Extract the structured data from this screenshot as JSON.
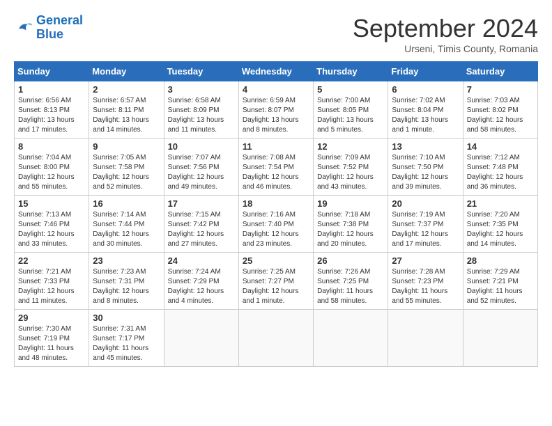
{
  "logo": {
    "line1": "General",
    "line2": "Blue"
  },
  "title": "September 2024",
  "location": "Urseni, Timis County, Romania",
  "days_of_week": [
    "Sunday",
    "Monday",
    "Tuesday",
    "Wednesday",
    "Thursday",
    "Friday",
    "Saturday"
  ],
  "weeks": [
    [
      {
        "num": "1",
        "info": "Sunrise: 6:56 AM\nSunset: 8:13 PM\nDaylight: 13 hours\nand 17 minutes."
      },
      {
        "num": "2",
        "info": "Sunrise: 6:57 AM\nSunset: 8:11 PM\nDaylight: 13 hours\nand 14 minutes."
      },
      {
        "num": "3",
        "info": "Sunrise: 6:58 AM\nSunset: 8:09 PM\nDaylight: 13 hours\nand 11 minutes."
      },
      {
        "num": "4",
        "info": "Sunrise: 6:59 AM\nSunset: 8:07 PM\nDaylight: 13 hours\nand 8 minutes."
      },
      {
        "num": "5",
        "info": "Sunrise: 7:00 AM\nSunset: 8:05 PM\nDaylight: 13 hours\nand 5 minutes."
      },
      {
        "num": "6",
        "info": "Sunrise: 7:02 AM\nSunset: 8:04 PM\nDaylight: 13 hours\nand 1 minute."
      },
      {
        "num": "7",
        "info": "Sunrise: 7:03 AM\nSunset: 8:02 PM\nDaylight: 12 hours\nand 58 minutes."
      }
    ],
    [
      {
        "num": "8",
        "info": "Sunrise: 7:04 AM\nSunset: 8:00 PM\nDaylight: 12 hours\nand 55 minutes."
      },
      {
        "num": "9",
        "info": "Sunrise: 7:05 AM\nSunset: 7:58 PM\nDaylight: 12 hours\nand 52 minutes."
      },
      {
        "num": "10",
        "info": "Sunrise: 7:07 AM\nSunset: 7:56 PM\nDaylight: 12 hours\nand 49 minutes."
      },
      {
        "num": "11",
        "info": "Sunrise: 7:08 AM\nSunset: 7:54 PM\nDaylight: 12 hours\nand 46 minutes."
      },
      {
        "num": "12",
        "info": "Sunrise: 7:09 AM\nSunset: 7:52 PM\nDaylight: 12 hours\nand 43 minutes."
      },
      {
        "num": "13",
        "info": "Sunrise: 7:10 AM\nSunset: 7:50 PM\nDaylight: 12 hours\nand 39 minutes."
      },
      {
        "num": "14",
        "info": "Sunrise: 7:12 AM\nSunset: 7:48 PM\nDaylight: 12 hours\nand 36 minutes."
      }
    ],
    [
      {
        "num": "15",
        "info": "Sunrise: 7:13 AM\nSunset: 7:46 PM\nDaylight: 12 hours\nand 33 minutes."
      },
      {
        "num": "16",
        "info": "Sunrise: 7:14 AM\nSunset: 7:44 PM\nDaylight: 12 hours\nand 30 minutes."
      },
      {
        "num": "17",
        "info": "Sunrise: 7:15 AM\nSunset: 7:42 PM\nDaylight: 12 hours\nand 27 minutes."
      },
      {
        "num": "18",
        "info": "Sunrise: 7:16 AM\nSunset: 7:40 PM\nDaylight: 12 hours\nand 23 minutes."
      },
      {
        "num": "19",
        "info": "Sunrise: 7:18 AM\nSunset: 7:38 PM\nDaylight: 12 hours\nand 20 minutes."
      },
      {
        "num": "20",
        "info": "Sunrise: 7:19 AM\nSunset: 7:37 PM\nDaylight: 12 hours\nand 17 minutes."
      },
      {
        "num": "21",
        "info": "Sunrise: 7:20 AM\nSunset: 7:35 PM\nDaylight: 12 hours\nand 14 minutes."
      }
    ],
    [
      {
        "num": "22",
        "info": "Sunrise: 7:21 AM\nSunset: 7:33 PM\nDaylight: 12 hours\nand 11 minutes."
      },
      {
        "num": "23",
        "info": "Sunrise: 7:23 AM\nSunset: 7:31 PM\nDaylight: 12 hours\nand 8 minutes."
      },
      {
        "num": "24",
        "info": "Sunrise: 7:24 AM\nSunset: 7:29 PM\nDaylight: 12 hours\nand 4 minutes."
      },
      {
        "num": "25",
        "info": "Sunrise: 7:25 AM\nSunset: 7:27 PM\nDaylight: 12 hours\nand 1 minute."
      },
      {
        "num": "26",
        "info": "Sunrise: 7:26 AM\nSunset: 7:25 PM\nDaylight: 11 hours\nand 58 minutes."
      },
      {
        "num": "27",
        "info": "Sunrise: 7:28 AM\nSunset: 7:23 PM\nDaylight: 11 hours\nand 55 minutes."
      },
      {
        "num": "28",
        "info": "Sunrise: 7:29 AM\nSunset: 7:21 PM\nDaylight: 11 hours\nand 52 minutes."
      }
    ],
    [
      {
        "num": "29",
        "info": "Sunrise: 7:30 AM\nSunset: 7:19 PM\nDaylight: 11 hours\nand 48 minutes."
      },
      {
        "num": "30",
        "info": "Sunrise: 7:31 AM\nSunset: 7:17 PM\nDaylight: 11 hours\nand 45 minutes."
      },
      {
        "num": "",
        "info": ""
      },
      {
        "num": "",
        "info": ""
      },
      {
        "num": "",
        "info": ""
      },
      {
        "num": "",
        "info": ""
      },
      {
        "num": "",
        "info": ""
      }
    ]
  ]
}
